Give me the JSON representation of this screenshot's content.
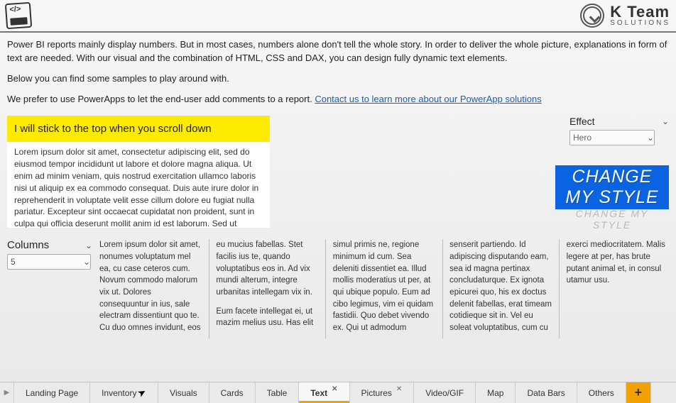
{
  "brand": {
    "name": "K Team",
    "sub": "SOLUTIONS"
  },
  "intro": {
    "p1": "Power BI reports mainly display numbers. But in most cases, numbers alone don't tell the whole story. In order to deliver the whole picture, explanations in form of text are needed. With our visual and the combination of HTML, CSS and DAX, you can design fully dynamic text elements.",
    "p2": "Below you can find some samples to play around with.",
    "p3_prefix": "We prefer to use PowerApps to let the end-user add comments to a report. ",
    "p3_link": "Contact us to learn more about our PowerApp solutions"
  },
  "sticky_text": "I will stick to the top when you scroll down",
  "lorem_scroll": "Lorem ipsum dolor sit amet, consectetur adipiscing elit, sed do eiusmod tempor incididunt ut labore et dolore magna aliqua. Ut enim ad minim veniam, quis nostrud exercitation ullamco laboris nisi ut aliquip ex ea commodo consequat. Duis aute irure dolor in reprehenderit in voluptate velit esse cillum dolore eu fugiat nulla pariatur. Excepteur sint occaecat cupidatat non proident, sunt in culpa qui officia deserunt mollit anim id est laborum. Sed ut perspiciatis unde omnis iste natus error sit voluptatem accusantium doloremque laudantium, totam rem aperiam, eaque ipsa quae ab illo inventore veritatis et quasi architecto beatae vitae dicta sunt explicabo. Nemo enim ipsam voluptatem quia voluptas sit",
  "effect": {
    "label": "Effect",
    "value": "Hero"
  },
  "style_banner": "CHANGE MY STYLE",
  "style_shadow": "CHANGE MY STYLE",
  "columns": {
    "label": "Columns",
    "value": "5",
    "text": "Lorem ipsum dolor sit amet, nonumes voluptatum mel ea, cu case ceteros cum. Novum commodo malorum vix ut. Dolores consequuntur in ius, sale electram dissentiunt quo te. Cu duo omnes invidunt, eos eu mucius fabellas. Stet facilis ius te, quando voluptatibus eos in. Ad vix mundi alterum, integre urbanitas intellegam vix in.\n\nEum facete intellegat ei, ut mazim melius usu. Has elit simul primis ne, regione minimum id cum. Sea deleniti dissentiet ea. Illud mollis moderatius ut per, at qui ubique populo. Eum ad cibo legimus, vim ei quidam fastidii. Quo debet vivendo ex. Qui ut admodum senserit partiendo. Id adipiscing disputando eam, sea id magna pertinax concludaturque. Ex ignota epicurei quo, his ex doctus delenit fabellas, erat timeam cotidieque sit in. Vel eu soleat voluptatibus, cum cu exerci mediocritatem. Malis legere at per, has brute putant animal et, in consul utamur usu."
  },
  "tabs": [
    {
      "label": "Landing Page",
      "closable": false,
      "active": false
    },
    {
      "label": "Inventory",
      "closable": false,
      "active": false,
      "pointer": true
    },
    {
      "label": "Visuals",
      "closable": false,
      "active": false
    },
    {
      "label": "Cards",
      "closable": false,
      "active": false
    },
    {
      "label": "Table",
      "closable": false,
      "active": false
    },
    {
      "label": "Text",
      "closable": true,
      "active": true
    },
    {
      "label": "Pictures",
      "closable": true,
      "active": false
    },
    {
      "label": "Video/GIF",
      "closable": false,
      "active": false
    },
    {
      "label": "Map",
      "closable": false,
      "active": false
    },
    {
      "label": "Data Bars",
      "closable": false,
      "active": false
    },
    {
      "label": "Others",
      "closable": false,
      "active": false
    }
  ]
}
